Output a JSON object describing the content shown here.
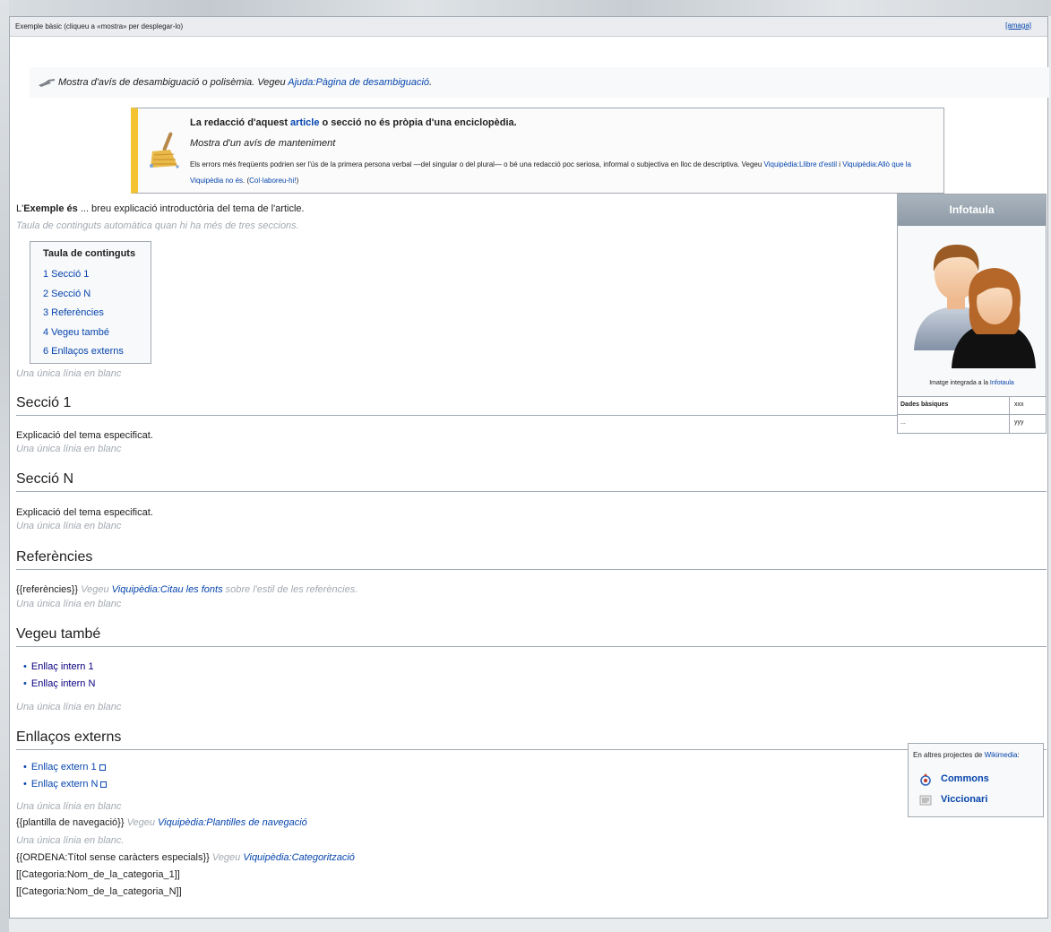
{
  "header": {
    "title": "Exemple bàsic (cliqueu a «mostra» per desplegar-lo)",
    "hide_label": "[amaga]"
  },
  "hatnote": {
    "text": "Mostra d'avís de desambiguació o polisèmia. Vegeu ",
    "link": "Ajuda:Pàgina de desambiguació",
    "end": "."
  },
  "ambox": {
    "line1_pre": "La redacció d'aquest ",
    "line1_link": "article",
    "line1_post": " o secció no és pròpia d'una enciclopèdia.",
    "line2": "Mostra d'un avís de manteniment",
    "line3_text": "Els errors més freqüents podrien ser l'ús de la primera persona verbal —del singular o del plural— o bé una redacció poc seriosa, informal o subjectiva en lloc de descriptiva. Vegeu ",
    "line3_link1": "Viquipèdia:Llibre d'estil",
    "line3_mid": " i ",
    "line3_link2": "Viquipèdia:Allò que la Viquipèdia no és",
    "line3_end": ". (",
    "line3_link3": "Col·laboreu-hi!",
    "line3_close": ")"
  },
  "intro": {
    "pre": "L'",
    "bold1": "Exemple",
    "mid": " ",
    "bold2": "és",
    "post": " ... breu explicació introductòria del tema de l'article."
  },
  "notes": {
    "toc_auto": "Taula de continguts automàtica quan hi ha més de tres seccions.",
    "blank": "Una única línia en blanc",
    "blank_dot": "Una única línia en blanc."
  },
  "toc": {
    "title": "Taula de continguts",
    "items": [
      "1 Secció 1",
      "2 Secció N",
      "3 Referències",
      "4 Vegeu també",
      "6 Enllaços externs"
    ]
  },
  "sections": {
    "s1": "Secció 1",
    "sN": "Secció N",
    "refs": "Referències",
    "see": "Vegeu també",
    "ext": "Enllaços externs"
  },
  "body": {
    "explanation": "Explicació del tema especificat.",
    "refs_tpl": "{{referències}}",
    "refs_note_pre": "Vegeu ",
    "refs_note_link": "Viquipèdia:Citau les fonts",
    "refs_note_post": " sobre l'estil de les referències.",
    "see_items": [
      "Enllaç intern 1",
      "Enllaç intern N"
    ],
    "ext_items": [
      "Enllaç extern 1",
      "Enllaç extern N"
    ],
    "nav_tpl": "{{plantilla de navegació}}",
    "nav_note_pre": "Vegeu ",
    "nav_note_link": "Viquipèdia:Plantilles de navegació",
    "order_tpl": "{{ORDENA:Títol sense caràcters especials}}",
    "order_note_pre": "Vegeu ",
    "order_note_link": "Viquipèdia:Categorització",
    "cat1": "[[Categoria:Nom_de_la_categoria_1]]",
    "catN": "[[Categoria:Nom_de_la_categoria_N]]"
  },
  "infobox": {
    "title": "Infotaula",
    "caption_pre": "Imatge integrada a la ",
    "caption_link": "Infotaula",
    "rows": [
      {
        "key": "Dades bàsiques",
        "value": "xxx"
      },
      {
        "key": "...",
        "value": "yyy"
      }
    ]
  },
  "sister": {
    "title_pre": "En altres projectes de ",
    "title_link": "Wikimedia",
    "title_end": ":",
    "items": [
      "Commons",
      "Viccionari"
    ]
  },
  "colors": {
    "link": "#0645ad",
    "ambox_stripe": "#f4c430",
    "note": "#a2a9b1"
  }
}
